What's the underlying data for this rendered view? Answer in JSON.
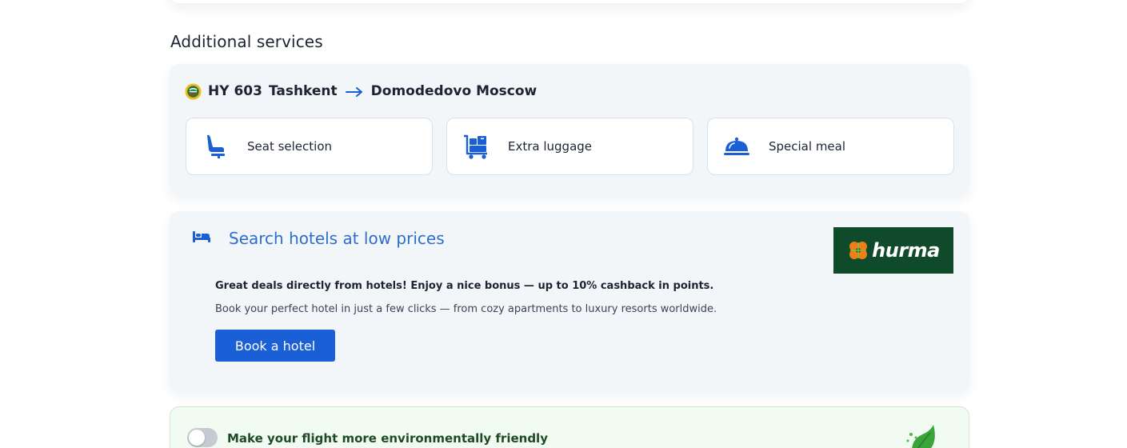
{
  "section": {
    "title": "Additional services"
  },
  "flight": {
    "flight_number": "HY 603",
    "origin": "Tashkent",
    "destination": "Domodedovo Moscow",
    "airline_logo_icon": "uzbekistan-airways-logo-icon",
    "arrow_icon": "arrow-right-icon"
  },
  "services": [
    {
      "label": "Seat selection",
      "icon": "seat-icon"
    },
    {
      "label": "Extra luggage",
      "icon": "luggage-cart-icon"
    },
    {
      "label": "Special meal",
      "icon": "cloche-icon"
    }
  ],
  "hotel": {
    "title": "Search hotels at low prices",
    "icon": "bed-icon",
    "partner_logo_text": "hurma",
    "lead": "Great deals directly from hotels! Enjoy a nice bonus — up to 10% cashback in points.",
    "description": "Book your perfect hotel in just a few clicks — from cozy apartments to luxury resorts worldwide.",
    "button_label": "Book a hotel"
  },
  "eco": {
    "label": "Make your flight more environmentally friendly",
    "toggle_state": "off",
    "icon": "leaf-icon"
  },
  "colors": {
    "accent": "#1a5fd6",
    "link_blue": "#2d6ecb",
    "card_bg": "#f3f6f9",
    "partner_green": "#0f4a2a",
    "eco_bg": "#f1fbf2"
  }
}
